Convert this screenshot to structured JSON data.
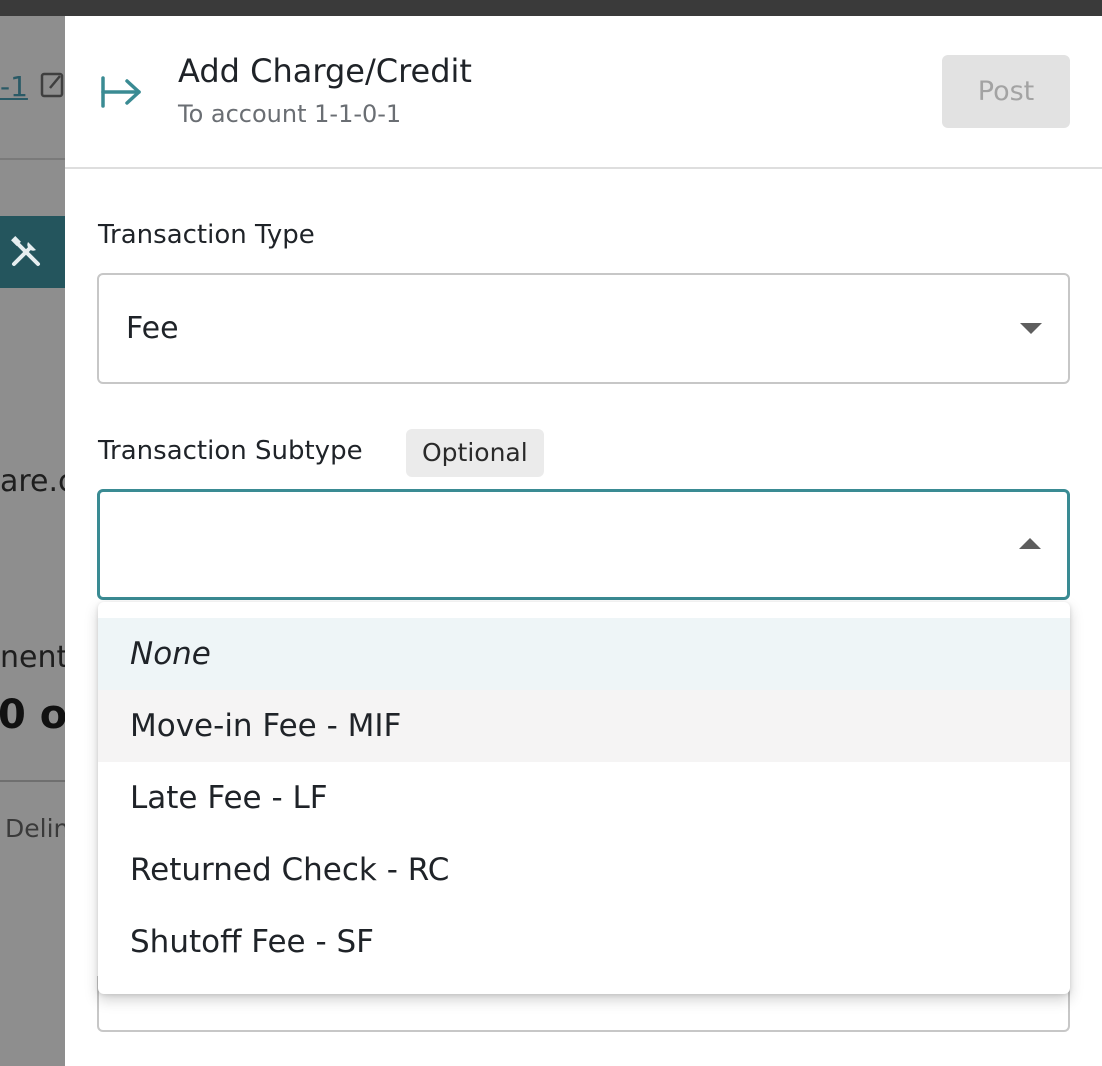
{
  "background": {
    "link_fragment": "-1",
    "text_fragment_1": "are.c",
    "text_fragment_2": "nent",
    "text_fragment_3": "0 o",
    "text_fragment_4": "Delin"
  },
  "drawer": {
    "title": "Add Charge/Credit",
    "subtitle": "To account 1-1-0-1",
    "post_label": "Post",
    "transaction_type": {
      "label": "Transaction Type",
      "value": "Fee"
    },
    "transaction_subtype": {
      "label": "Transaction Subtype",
      "badge": "Optional",
      "value": "",
      "options": [
        "None",
        "Move-in Fee - MIF",
        "Late Fee - LF",
        "Returned Check - RC",
        "Shutoff Fee - SF"
      ]
    }
  },
  "colors": {
    "accent": "#3a8b93",
    "overlay": "#8e8e8e",
    "highlight_row": "#eef5f7",
    "hover_row": "#f5f4f4"
  }
}
